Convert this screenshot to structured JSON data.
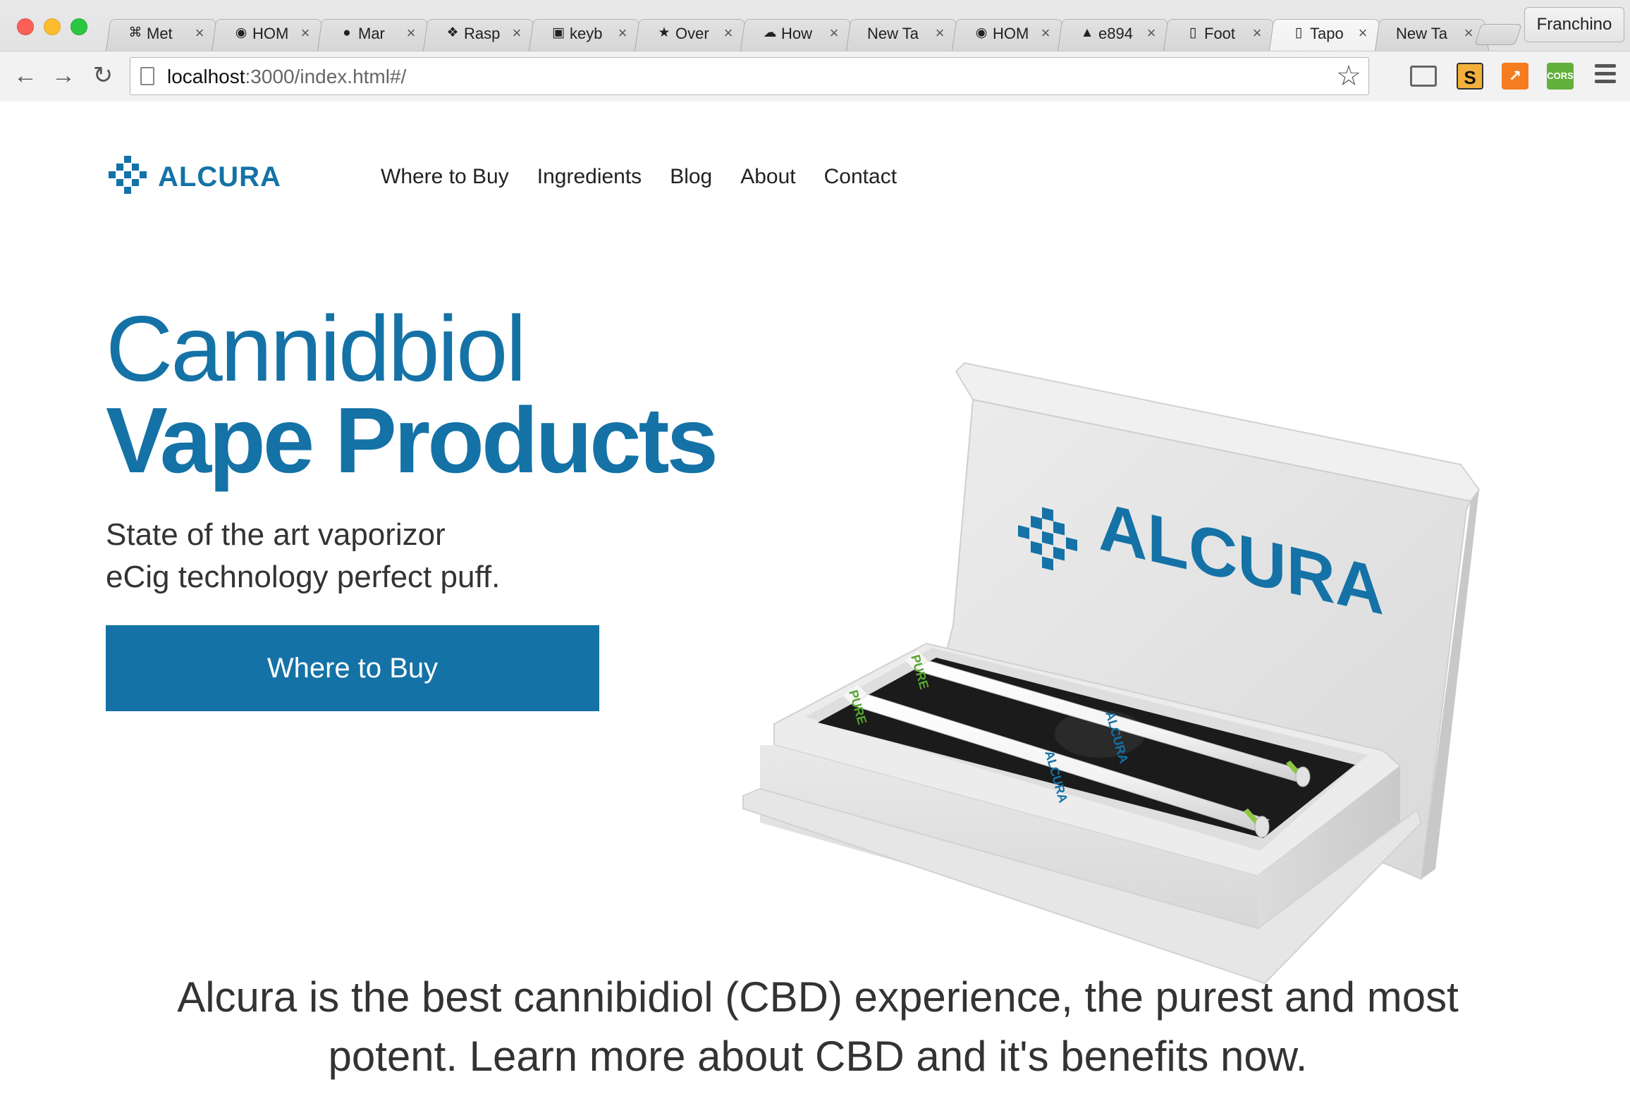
{
  "browser": {
    "tabs": [
      {
        "icon": "apple-icon",
        "glyph": "⌘",
        "title": "Met"
      },
      {
        "icon": "eye-icon",
        "glyph": "◉",
        "title": "HOM"
      },
      {
        "icon": "github-icon",
        "glyph": "●",
        "title": "Mar"
      },
      {
        "icon": "raspberry-icon",
        "glyph": "❖",
        "title": "Rasp"
      },
      {
        "icon": "rpi-icon",
        "glyph": "▣",
        "title": "keyb"
      },
      {
        "icon": "star-badge-icon",
        "glyph": "★",
        "title": "Over"
      },
      {
        "icon": "cloud-icon",
        "glyph": "☁",
        "title": "How"
      },
      {
        "icon": "",
        "glyph": "",
        "title": "New Ta"
      },
      {
        "icon": "eye-icon",
        "glyph": "◉",
        "title": "HOM"
      },
      {
        "icon": "tree-icon",
        "glyph": "▲",
        "title": "e894"
      },
      {
        "icon": "page-icon",
        "glyph": "▯",
        "title": "Foot"
      },
      {
        "icon": "page-icon",
        "glyph": "▯",
        "title": "Tapo"
      },
      {
        "icon": "",
        "glyph": "",
        "title": "New Ta"
      }
    ],
    "active_tab_index": 11,
    "close_glyph": "×",
    "profile_name": "Franchino",
    "url_host": "localhost",
    "url_rest": ":3000/index.html#/",
    "back_glyph": "←",
    "forward_glyph": "→",
    "reload_glyph": "↻",
    "star_glyph": "☆",
    "extensions": {
      "s_label": "S",
      "chart_label": "↗",
      "cors_label": "CORS"
    }
  },
  "site": {
    "brand": "ALCURA",
    "brand_color": "#1472a6",
    "nav": [
      "Where to Buy",
      "Ingredients",
      "Blog",
      "About",
      "Contact"
    ],
    "hero": {
      "title_line1": "Cannidbiol",
      "title_line2": "Vape Products",
      "subtitle_line1": "State of the art vaporizor",
      "subtitle_line2": "eCig technology perfect puff.",
      "cta_label": "Where to Buy"
    },
    "product_image": {
      "box_brand": "ALCURA",
      "pen_label": "PURE",
      "pen_brand": "ALCURA"
    },
    "tagline_line1": "Alcura is the best cannibidiol (CBD) experience, the purest and most",
    "tagline_line2": "potent. Learn more about CBD and it's benefits now."
  }
}
